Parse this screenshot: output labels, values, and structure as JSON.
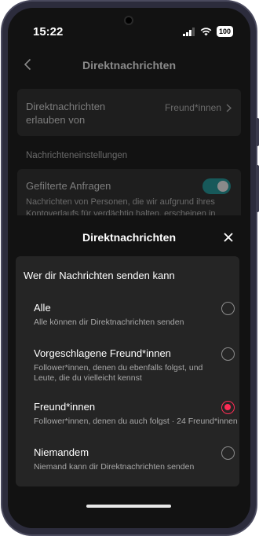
{
  "status_bar": {
    "time": "15:22",
    "battery": "100"
  },
  "page": {
    "title": "Direktnachrichten",
    "setting": {
      "label": "Direktnachrichten erlauben von",
      "value": "Freund*innen"
    },
    "section_header": "Nachrichteneinstellungen",
    "filter": {
      "title": "Gefilterte Anfragen",
      "description": "Nachrichten von Personen, die wir aufgrund ihres Kontoverlaufs für verdächtig halten, erscheinen in",
      "enabled": true
    }
  },
  "sheet": {
    "title": "Direktnachrichten",
    "header": "Wer dir Nachrichten senden kann",
    "options": [
      {
        "label": "Alle",
        "description": "Alle können dir Direktnachrichten senden",
        "selected": false
      },
      {
        "label": "Vorgeschlagene Freund*innen",
        "description": "Follower*innen, denen du ebenfalls folgst, und Leute, die du vielleicht kennst",
        "selected": false
      },
      {
        "label": "Freund*innen",
        "description": "Follower*innen, denen du auch folgst · 24 Freund*innen :",
        "selected": true
      },
      {
        "label": "Niemandem",
        "description": "Niemand kann dir Direktnachrichten senden",
        "selected": false
      }
    ]
  },
  "colors": {
    "accent": "#fe2c55",
    "toggle_on": "#17595a",
    "background": "#121212",
    "card": "#252525"
  },
  "icons": [
    "back-icon",
    "chevron-right-icon",
    "close-icon",
    "signal-icon",
    "wifi-icon",
    "battery-icon",
    "camera-icon"
  ]
}
